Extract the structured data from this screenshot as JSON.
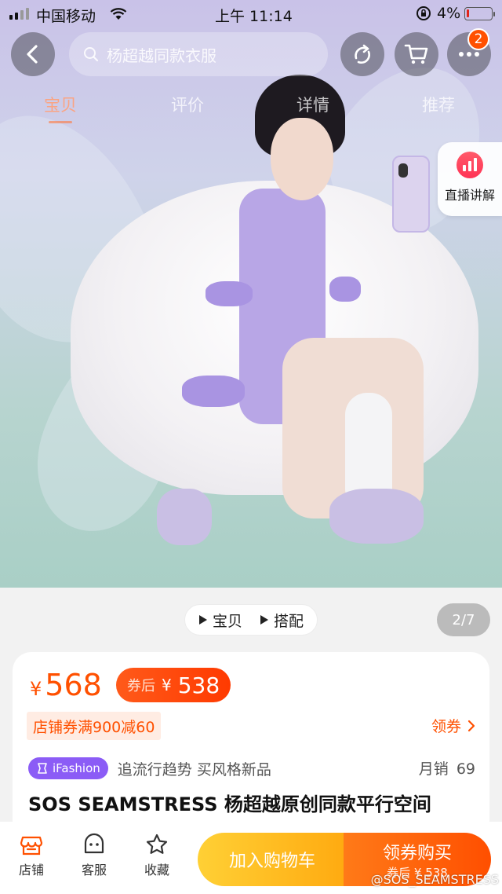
{
  "status_bar": {
    "carrier": "中国移动",
    "time": "上午 11:14",
    "battery": "4%"
  },
  "nav": {
    "search_placeholder": "杨超越同款衣服",
    "more_badge": "2",
    "tabs": [
      "宝贝",
      "评价",
      "详情",
      "推荐"
    ],
    "active_tab": "宝贝"
  },
  "live": {
    "label": "直播讲解"
  },
  "media": {
    "switch": [
      "宝贝",
      "搭配"
    ],
    "counter": "2/7"
  },
  "product": {
    "currency": "¥",
    "price": "568",
    "coupon_label": "券后",
    "coupon_price": "538",
    "shop_coupon": "店铺券满900减60",
    "get_coupon": "领券",
    "brand_tag": "iFashion",
    "tagline": "追流行趋势 买风格新品",
    "sales_label": "月销",
    "sales_value": "69",
    "title": "SOS SEAMSTRESS 杨超越原创同款平行空间"
  },
  "bottom_bar": {
    "items": [
      "店铺",
      "客服",
      "收藏"
    ],
    "add_cart": "加入购物车",
    "buy_label": "领券购买",
    "buy_sub": "券后 ¥ 538"
  },
  "watermark": "@SOS_SEAMSTRESS",
  "colors": {
    "accent": "#ff5000",
    "cart_button": "#ffb81c",
    "ifashion": "#8b5cf6"
  },
  "icons": [
    "back-icon",
    "search-icon",
    "share-icon",
    "cart-icon",
    "more-icon",
    "live-stats-icon",
    "play-icon",
    "chevron-right-icon",
    "shop-icon",
    "service-icon",
    "star-icon"
  ]
}
